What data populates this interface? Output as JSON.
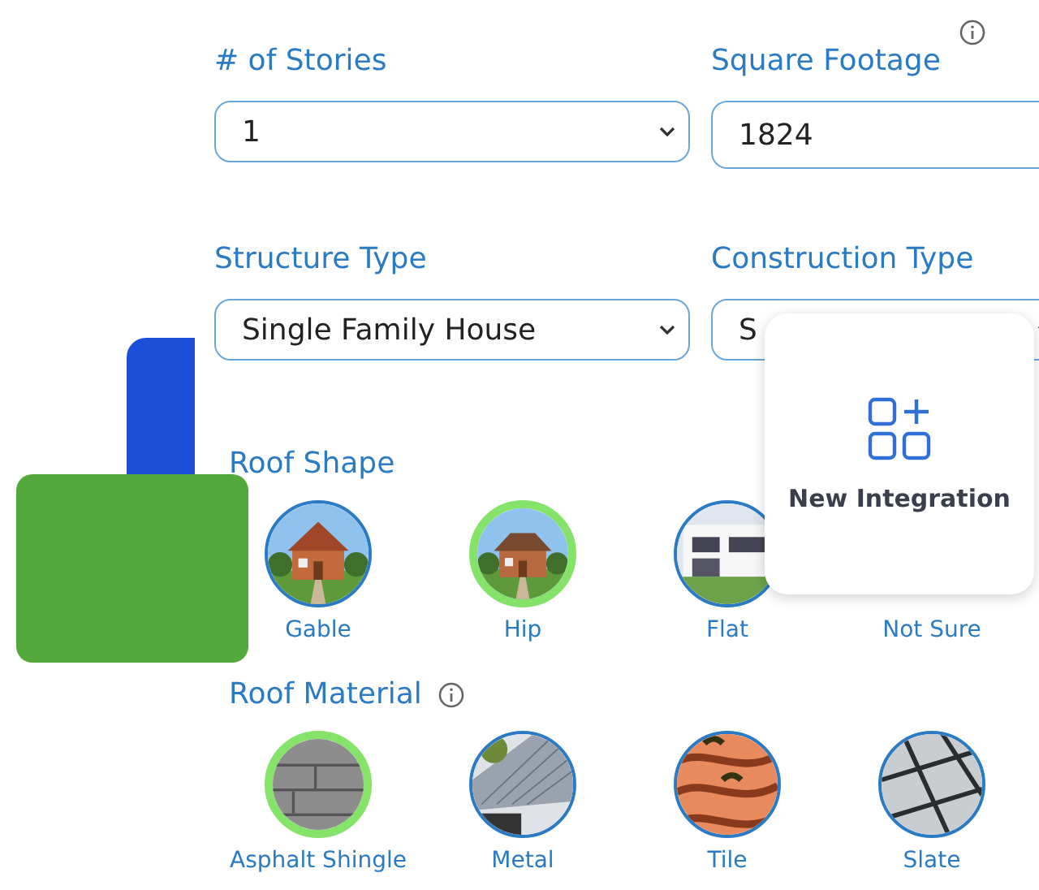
{
  "fields": [
    {
      "label": "# of Stories",
      "kind": "select",
      "value": "1",
      "info": false
    },
    {
      "label": "Square Footage",
      "kind": "input",
      "value": "1824",
      "info": true
    },
    {
      "label": "Structure Type",
      "kind": "select",
      "value": "Single Family House",
      "info": false
    },
    {
      "label": "Construction Type",
      "kind": "select",
      "value": "S",
      "info": false
    }
  ],
  "roof_shape": {
    "title": "Roof Shape",
    "info": false,
    "options": [
      {
        "label": "Gable",
        "kind": "picture",
        "selected": false
      },
      {
        "label": "Hip",
        "kind": "picture",
        "selected": true
      },
      {
        "label": "Flat",
        "kind": "picture",
        "selected": false
      },
      {
        "label": "Not Sure",
        "kind": "text",
        "selected": false
      }
    ]
  },
  "roof_material": {
    "title": "Roof Material",
    "info": true,
    "options": [
      {
        "label": "Asphalt Shingle",
        "kind": "picture",
        "selected": true
      },
      {
        "label": "Metal",
        "kind": "picture",
        "selected": false
      },
      {
        "label": "Tile",
        "kind": "picture",
        "selected": false
      },
      {
        "label": "Slate",
        "kind": "picture",
        "selected": false
      }
    ]
  },
  "popup": {
    "label": "New Integration"
  }
}
